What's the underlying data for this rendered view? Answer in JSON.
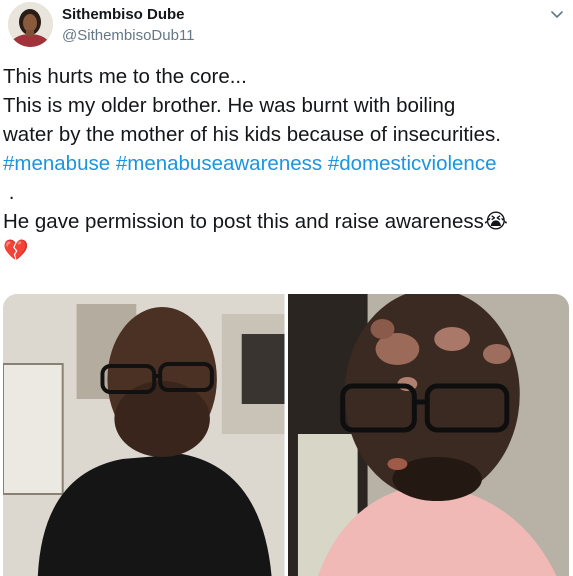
{
  "tweet": {
    "author_name": "Sithembiso Dube",
    "author_handle": "@SithembisoDub11",
    "lines": [
      "This hurts me to the core...",
      "This is my older brother. He was burnt with boiling",
      "water by the mother of his kids because of insecurities."
    ],
    "hashtags": [
      "#menabuse",
      "#menabuseawareness",
      "#domesticviolence"
    ],
    "dot_line": ".",
    "last_line": "He gave permission to post this and raise awareness",
    "emoji_crying": "😭",
    "emoji_broken_heart": "💔"
  },
  "icons": {
    "menu": "chevron-down-icon"
  },
  "colors": {
    "link": "#1b95e0",
    "secondary_text": "#657786",
    "primary_text": "#14171a"
  }
}
